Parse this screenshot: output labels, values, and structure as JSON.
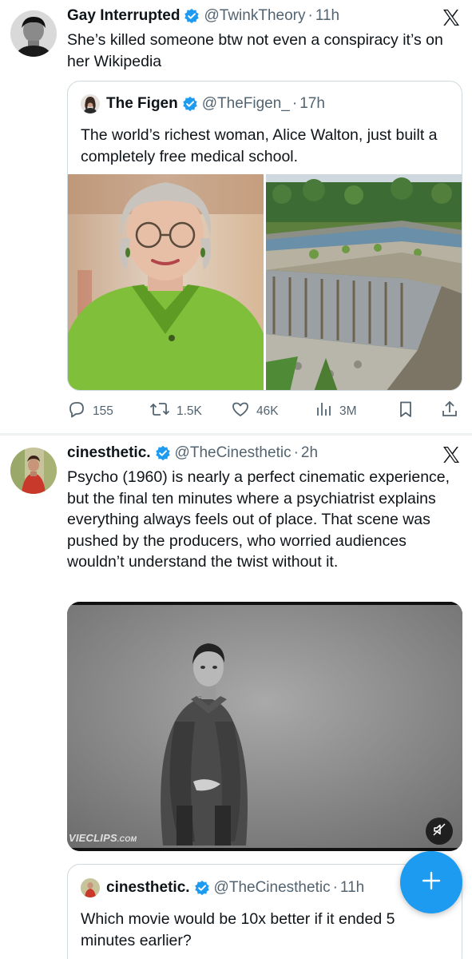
{
  "tweets": [
    {
      "author_name": "Gay Interrupted",
      "handle": "@TwinkTheory",
      "separator": "·",
      "time": "11h",
      "text": "She’s killed someone btw not even a conspiracy it’s on her Wikipedia",
      "quote": {
        "author_name": "The Figen",
        "handle": "@TheFigen_",
        "separator": "·",
        "time": "17h",
        "text": "The world’s richest woman, Alice Walton, just built a completely free medical school."
      },
      "stats": {
        "replies": "155",
        "reposts": "1.5K",
        "likes": "46K",
        "views": "3M"
      }
    },
    {
      "author_name": "cinesthetic.",
      "handle": "@TheCinesthetic",
      "separator": "·",
      "time": "2h",
      "text": "Psycho (1960) is nearly a perfect cinematic experience, but the final ten minutes where a psychiatrist explains everything always feels out of place. That scene was pushed by the producers, who worried audiences wouldn’t understand the twist without it.",
      "video_watermark": "VIECLIPS",
      "video_watermark_suffix": ".COM",
      "quote": {
        "author_name": "cinesthetic.",
        "handle": "@TheCinesthetic",
        "separator": "·",
        "time": "11h",
        "text": "Which movie would be 10x better if it ended 5 minutes earlier?"
      }
    }
  ],
  "icons": {
    "verified": "verified-badge-icon",
    "platform": "x-logo-icon",
    "reply": "reply-icon",
    "repost": "repost-icon",
    "like": "heart-icon",
    "views": "views-icon",
    "bookmark": "bookmark-icon",
    "share": "share-icon",
    "mute": "muted-speaker-icon",
    "compose": "plus-icon"
  },
  "colors": {
    "accent": "#1d9bf0",
    "text": "#0f1419",
    "secondary": "#536471",
    "border": "#cfd9de"
  }
}
